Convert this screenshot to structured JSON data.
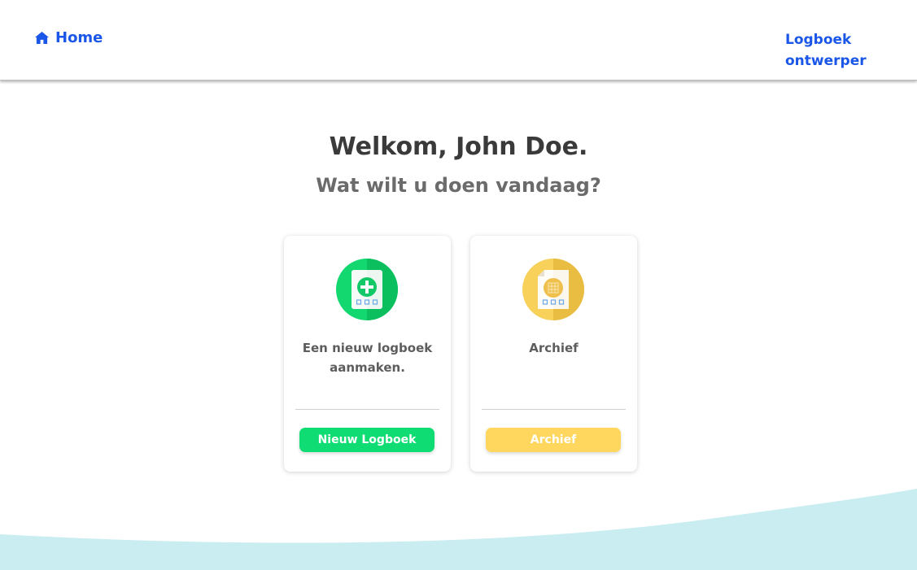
{
  "nav": {
    "home_label": "Home",
    "designer_label": "Logboek ontwerper"
  },
  "main": {
    "title": "Welkom, John Doe.",
    "subtitle": "Wat wilt u doen vandaag?"
  },
  "cards": [
    {
      "icon": "new-document-icon",
      "text": "Een nieuw logboek aanmaken.",
      "button_label": "Nieuw Logboek",
      "color": "#0fdc73"
    },
    {
      "icon": "archive-document-icon",
      "text": "Archief",
      "button_label": "Archief",
      "color": "#ffd75e"
    }
  ],
  "colors": {
    "link": "#1a56e8",
    "wave": "#c9edf1"
  }
}
